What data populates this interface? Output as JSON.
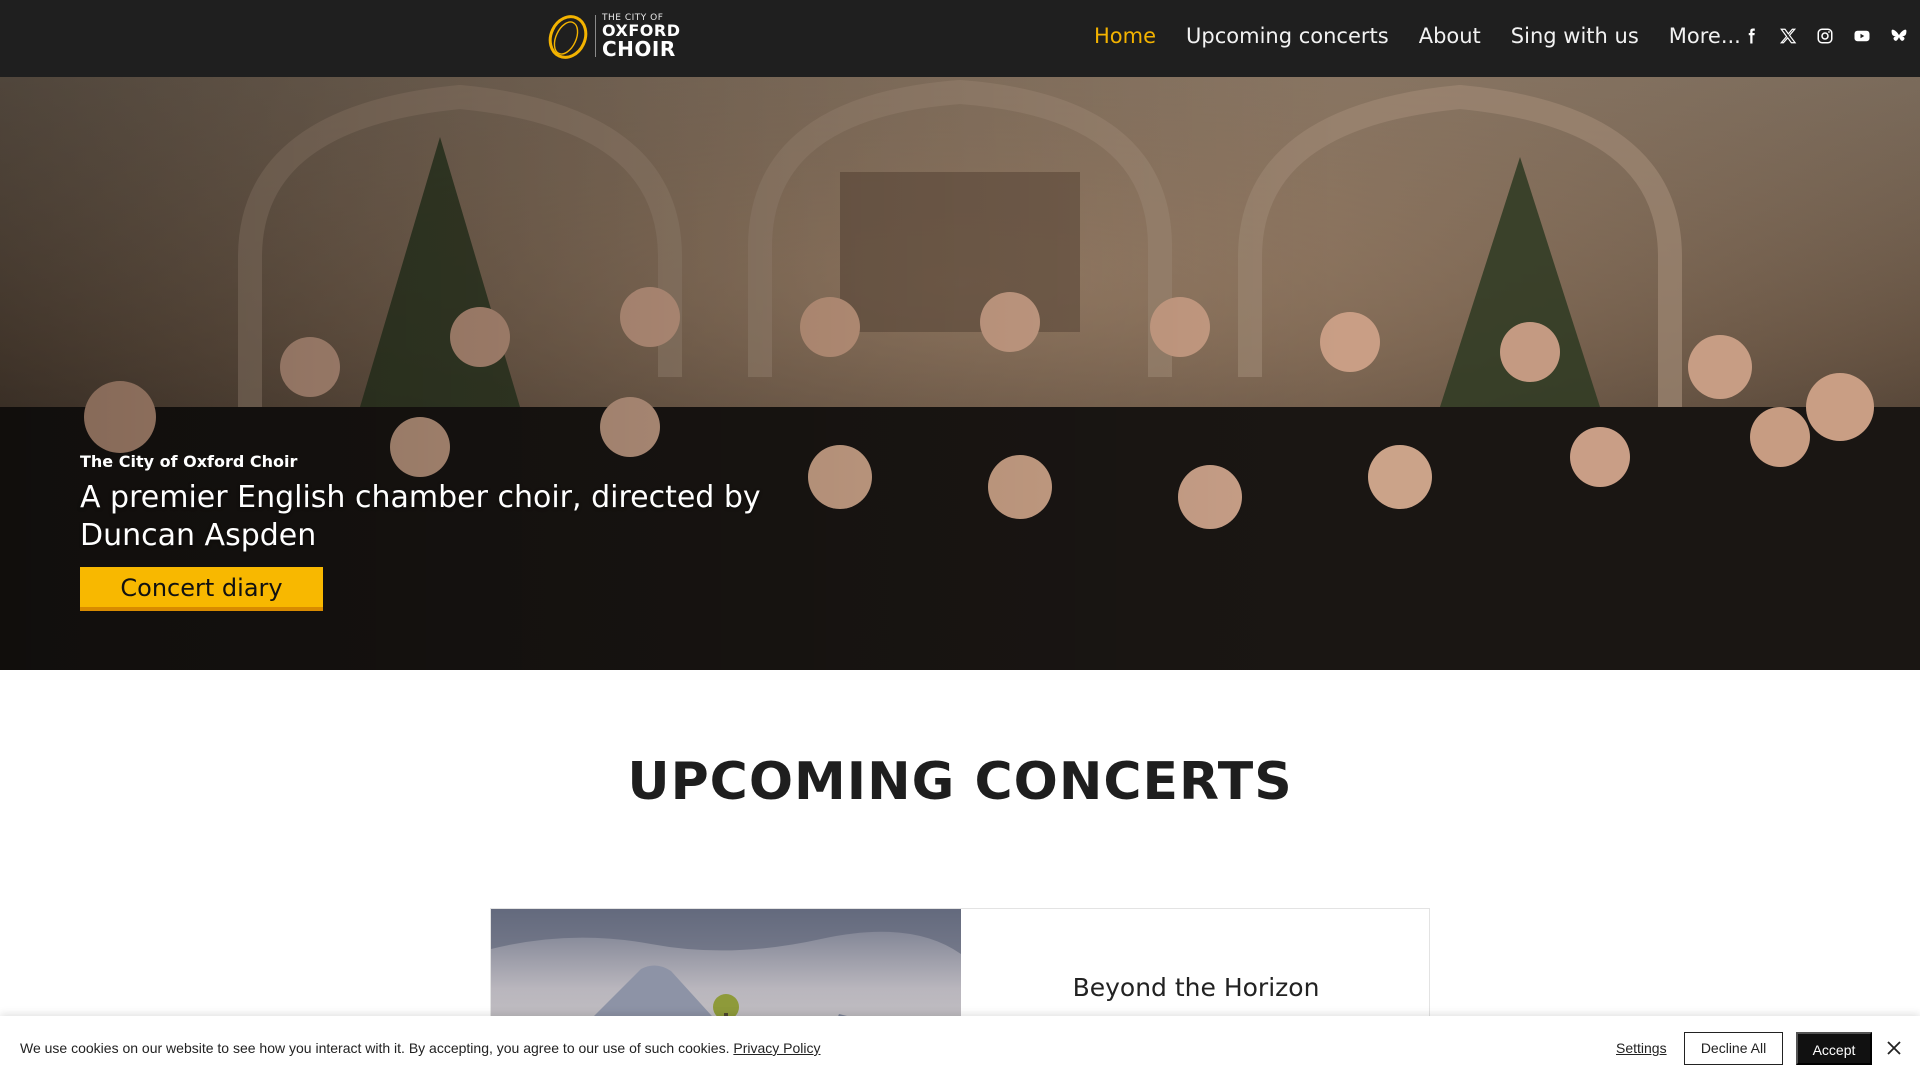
{
  "header": {
    "logo": {
      "line1": "THE CITY OF",
      "line2": "OXFORD",
      "line3": "CHOIR"
    },
    "nav": [
      {
        "label": "Home",
        "active": true
      },
      {
        "label": "Upcoming concerts",
        "active": false
      },
      {
        "label": "About",
        "active": false
      },
      {
        "label": "Sing with us",
        "active": false
      },
      {
        "label": "More...",
        "active": false
      }
    ],
    "social_icons": [
      "facebook-icon",
      "x-icon",
      "instagram-icon",
      "youtube-icon",
      "bluesky-icon"
    ]
  },
  "hero": {
    "eyebrow": "The City of Oxford Choir",
    "title": "A premier English chamber choir, directed by Duncan Aspden",
    "cta_label": "Concert diary"
  },
  "concerts": {
    "section_title": "UPCOMING CONCERTS",
    "items": [
      {
        "title": "Beyond the Horizon"
      }
    ]
  },
  "cookie_banner": {
    "text": "We use cookies on our website to see how you interact with it. By accepting, you agree to our use of such cookies.",
    "link_label": "Privacy Policy",
    "settings_label": "Settings",
    "decline_label": "Decline All",
    "accept_label": "Accept"
  },
  "colors": {
    "header_bg": "#1f1f1f",
    "accent": "#f3b300",
    "cta_bg": "#f8b800",
    "accept_bg": "#111111"
  }
}
